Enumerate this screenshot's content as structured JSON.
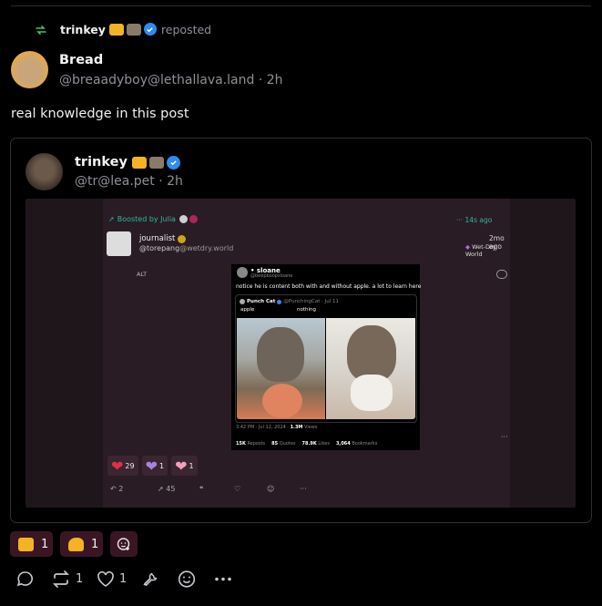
{
  "repost": {
    "user": "trinkey",
    "label": "reposted"
  },
  "post": {
    "name": "Bread",
    "handle": "@breaadyboy@lethallava.land",
    "sep": "·",
    "time": "2h",
    "text": "real knowledge in this post"
  },
  "quoted": {
    "name": "trinkey",
    "handle": "@tr@lea.pet",
    "sep": "·",
    "time": "2h"
  },
  "embed": {
    "boost_label": "Boosted by Julia",
    "boost_time": "··· 14s ago",
    "author_name": "journalist",
    "author_handle": "@torepang",
    "author_instance": "@wetdry.world",
    "author_time": "2mo ago",
    "author_server": "Wet-Dry World",
    "alt": "ALT",
    "tweet": {
      "name": "• sloane",
      "handle": "@beepboopsloane",
      "text": "notice he is content both with and without apple. a lot to learn here",
      "quote_name": "Punch Cat",
      "quote_handle": "@PunchingCat · Jul 11",
      "label_left": "apple",
      "label_right": "nothing",
      "timestamp": "3:42 PM · Jul 12, 2024 · ",
      "views_count": "1.3M",
      "views_label": " Views",
      "stats": [
        {
          "num": "15K",
          "label": "Reposts"
        },
        {
          "num": "85",
          "label": "Quotes"
        },
        {
          "num": "78.9K",
          "label": "Likes"
        },
        {
          "num": "3,064",
          "label": "Bookmarks"
        }
      ]
    },
    "reactions": [
      {
        "count": "29"
      },
      {
        "count": "1"
      },
      {
        "count": "1"
      }
    ],
    "actions": {
      "reply": "2",
      "boost": "45"
    }
  },
  "reactions": [
    {
      "count": "1"
    },
    {
      "count": "1"
    }
  ],
  "actions": {
    "repost": "1",
    "like": "1"
  }
}
